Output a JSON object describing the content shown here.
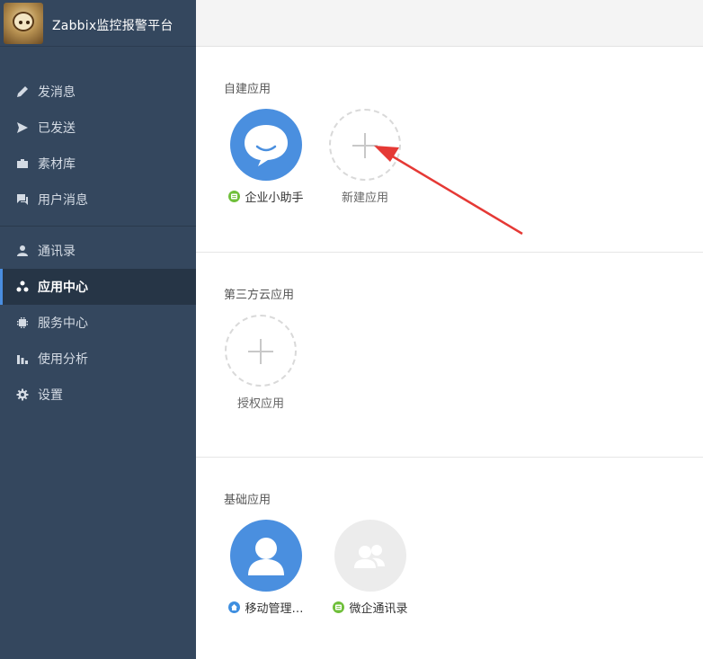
{
  "brand": {
    "title": "Zabbix监控报警平台",
    "logo_icon": "avatar-logo-icon"
  },
  "nav_group1": [
    {
      "label": "发消息",
      "icon": "pencil-icon"
    },
    {
      "label": "已发送",
      "icon": "send-icon"
    },
    {
      "label": "素材库",
      "icon": "briefcase-icon"
    },
    {
      "label": "用户消息",
      "icon": "chat-icon"
    }
  ],
  "nav_group2": [
    {
      "label": "通讯录",
      "icon": "person-icon",
      "active": false
    },
    {
      "label": "应用中心",
      "icon": "apps-icon",
      "active": true
    },
    {
      "label": "服务中心",
      "icon": "chip-icon",
      "active": false
    },
    {
      "label": "使用分析",
      "icon": "bar-chart-icon",
      "active": false
    },
    {
      "label": "设置",
      "icon": "gear-icon",
      "active": false
    }
  ],
  "sections": {
    "custom": {
      "title": "自建应用",
      "apps": [
        {
          "label": "企业小助手",
          "icon": "chat-bubble-icon",
          "badge_color": "#6fbf3a"
        },
        {
          "label": "新建应用",
          "icon": "plus-icon"
        }
      ]
    },
    "third_party": {
      "title": "第三方云应用",
      "apps": [
        {
          "label": "授权应用",
          "icon": "plus-icon"
        }
      ]
    },
    "basic": {
      "title": "基础应用",
      "apps": [
        {
          "label": "移动管理…",
          "icon": "person-icon",
          "badge_color": "#3f8fe0"
        },
        {
          "label": "微企通讯录",
          "icon": "group-icon",
          "badge_color": "#6fbf3a"
        }
      ]
    }
  },
  "colors": {
    "sidebar": "#34475e",
    "sidebar_active": "#263546",
    "accent": "#4a8ee0",
    "app_blue": "#4a8fdf",
    "arrow": "#e53935"
  }
}
